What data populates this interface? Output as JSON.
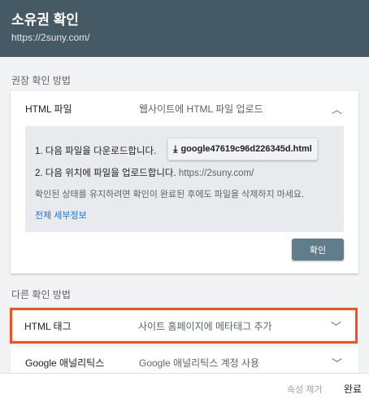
{
  "header": {
    "title": "소유권 확인",
    "url": "https://2suny.com/"
  },
  "recommended": {
    "label": "권장 확인 방법",
    "method_name": "HTML 파일",
    "method_desc": "웹사이트에 HTML 파일 업로드",
    "step1": "1. 다음 파일을 다운로드합니다.",
    "download_file": "google47619c96d226345d.html",
    "step2": "2. 다음 위치에 파일을 업로드합니다.",
    "step2_url": "https://2suny.com/",
    "hint": "확인된 상태를 유지하려면 확인이 완료된 후에도 파일을 삭제하지 마세요.",
    "details_link": "전체 세부정보",
    "confirm_button": "확인"
  },
  "other": {
    "label": "다른 확인 방법",
    "items": [
      {
        "name": "HTML 태그",
        "desc": "사이트 홈페이지에 메타태그 추가"
      },
      {
        "name": "Google 애널리틱스",
        "desc": "Google 애널리틱스 계정 사용"
      }
    ]
  },
  "footer": {
    "remove": "속성 제거",
    "done": "완료"
  },
  "colors": {
    "header": "#455a64",
    "highlight": "#f4511e",
    "link": "#1a73e8"
  }
}
